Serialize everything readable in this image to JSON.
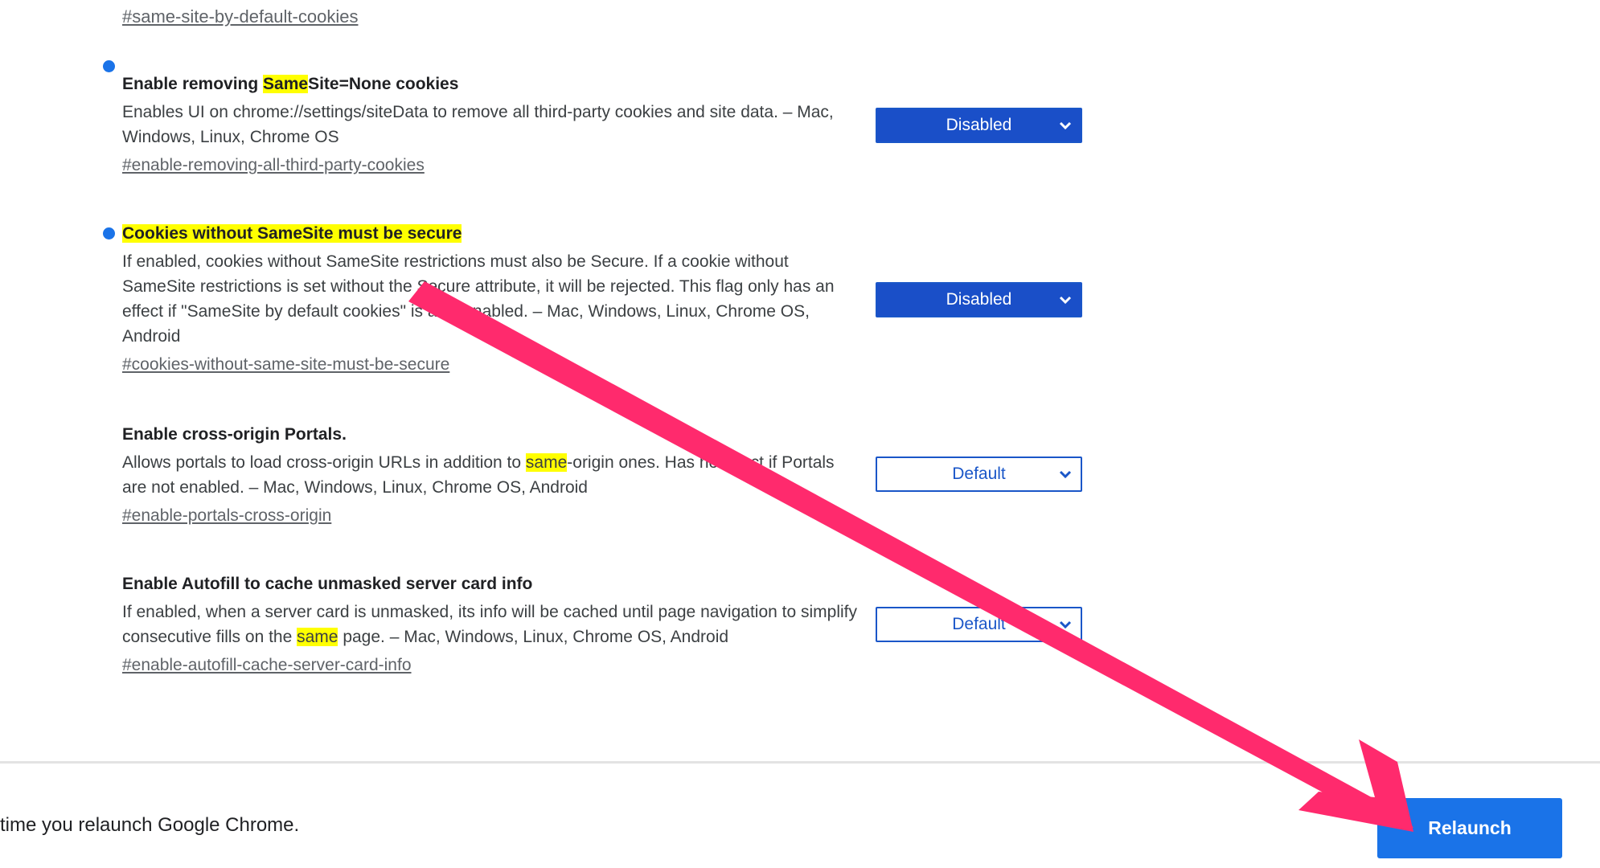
{
  "top_link": "#same-site-by-default-cookies",
  "flags": [
    {
      "title_parts": [
        "Enable removing ",
        "Same",
        "Site=None cookies"
      ],
      "desc": "Enables UI on chrome://settings/siteData to remove all third-party cookies and site data. – Mac, Windows, Linux, Chrome OS",
      "link": "#enable-removing-all-third-party-cookies",
      "select_value": "Disabled"
    },
    {
      "title": "Cookies without SameSite must be secure",
      "desc": "If enabled, cookies without SameSite restrictions must also be Secure. If a cookie without SameSite restrictions is set without the Secure attribute, it will be rejected. This flag only has an effect if \"SameSite by default cookies\" is also enabled. – Mac, Windows, Linux, Chrome OS, Android",
      "link": "#cookies-without-same-site-must-be-secure",
      "select_value": "Disabled"
    },
    {
      "title": "Enable cross-origin Portals.",
      "desc_parts": [
        "Allows portals to load cross-origin URLs in addition to ",
        "same",
        "-origin ones. Has no effect if Portals are not enabled. – Mac, Windows, Linux, Chrome OS, Android"
      ],
      "link": "#enable-portals-cross-origin",
      "select_value": "Default"
    },
    {
      "title": "Enable Autofill to cache unmasked server card info",
      "desc_parts": [
        "If enabled, when a server card is unmasked, its info will be cached until page navigation to simplify consecutive fills on the ",
        "same",
        " page. – Mac, Windows, Linux, Chrome OS, Android"
      ],
      "link": "#enable-autofill-cache-server-card-info",
      "select_value": "Default"
    }
  ],
  "footer": {
    "message": "time you relaunch Google Chrome.",
    "relaunch_label": "Relaunch"
  },
  "colors": {
    "accent": "#1a73e8",
    "select_filled": "#1a4fc8",
    "highlight": "#ffff00",
    "annotation_arrow": "#ff2a6d"
  }
}
